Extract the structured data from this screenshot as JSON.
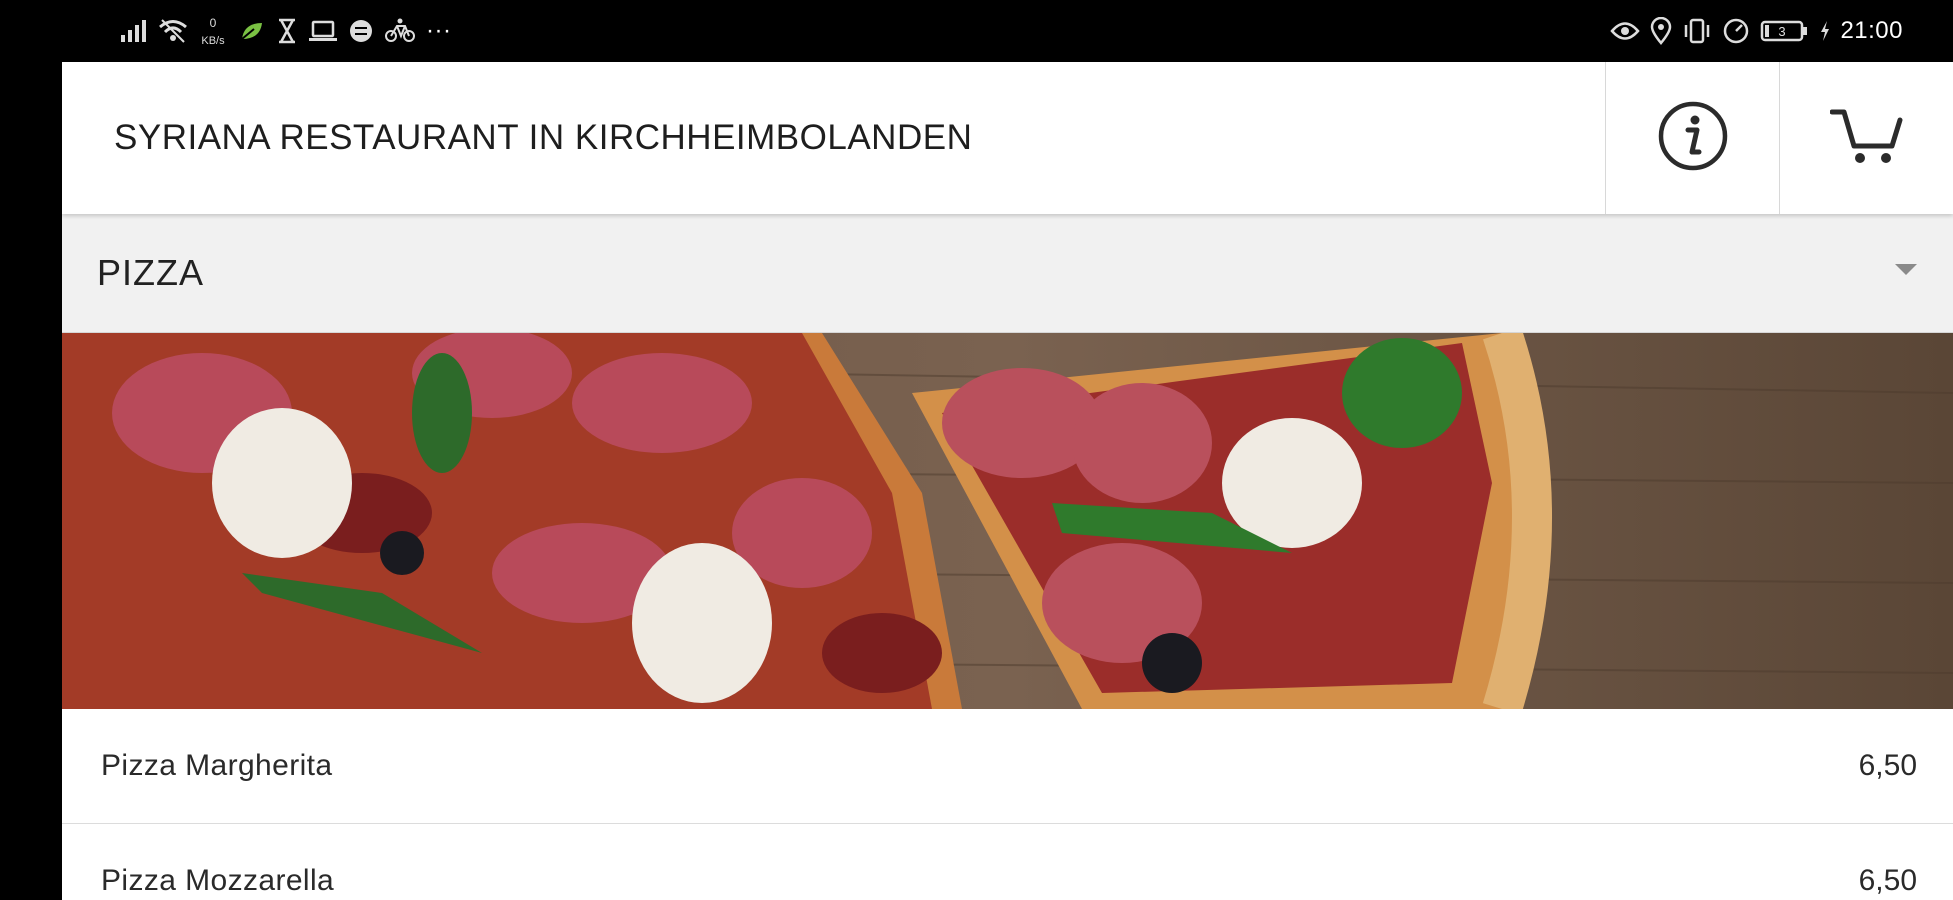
{
  "status_bar": {
    "time": "21:00",
    "battery_level": "3",
    "left_icons": [
      "signal-icon",
      "wifi-icon",
      "data-speed-icon",
      "leaf-icon",
      "hourglass-icon",
      "laptop-icon",
      "vpn-icon",
      "bike-icon",
      "more-dots-icon"
    ],
    "data_speed_line1": "0",
    "data_speed_line2": "KB/s",
    "more_indicator": "···",
    "right_icons": [
      "eye-icon",
      "location-icon",
      "vibrate-icon",
      "speedometer-icon",
      "battery-icon",
      "charging-icon"
    ]
  },
  "app_bar": {
    "title": "SYRIANA RESTAURANT IN KIRCHHEIMBOLANDEN",
    "info_icon": "info-icon",
    "cart_icon": "cart-icon"
  },
  "category": {
    "label": "PIZZA",
    "dropdown_icon": "caret-down-icon"
  },
  "hero": {
    "description": "pizza-photo"
  },
  "menu": {
    "items": [
      {
        "name": "Pizza Margherita",
        "price": "6,50"
      },
      {
        "name": "Pizza Mozzarella",
        "price": "6,50"
      }
    ]
  },
  "colors": {
    "status_bar_bg": "#000000",
    "app_bar_bg": "#ffffff",
    "category_bg": "#f1f1f1",
    "text": "#222222",
    "icon": "#2b2b2b"
  }
}
